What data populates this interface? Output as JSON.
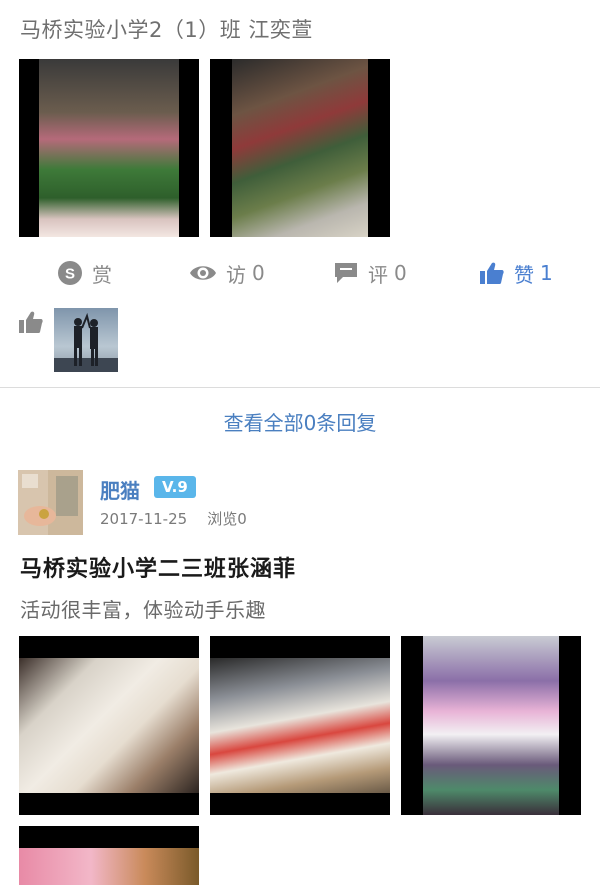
{
  "prev_post": {
    "subtitle": "马桥实验小学2（1）班 江奕萱",
    "actions": {
      "reward": {
        "label": "赏"
      },
      "views": {
        "label": "访",
        "count": "0"
      },
      "comments": {
        "label": "评",
        "count": "0"
      },
      "likes": {
        "label": "赞",
        "count": "1"
      }
    }
  },
  "view_all_replies": "查看全部0条回复",
  "post": {
    "author": "肥猫",
    "level": "V.9",
    "date": "2017-11-25",
    "views": "浏览0",
    "title": "马桥实验小学二三班张涵菲",
    "description": "活动很丰富，体验动手乐趣"
  },
  "colors": {
    "accent": "#4a7fc0",
    "liked": "#4a7fd0",
    "badge": "#5ab6ea",
    "icon_gray": "#8a8a8a"
  },
  "icons": {
    "reward": "skype-reward-icon",
    "views": "eye-icon",
    "comments": "comment-bubble-icon",
    "likes": "thumbs-up-icon"
  }
}
